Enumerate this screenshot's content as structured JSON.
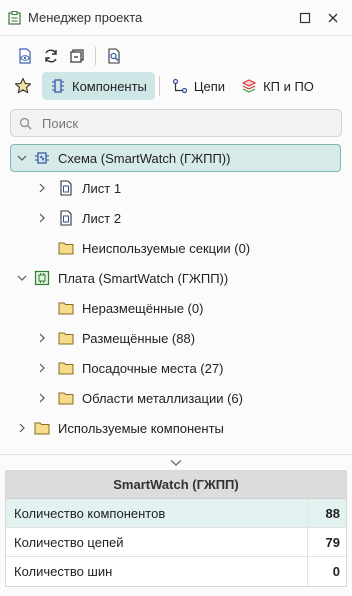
{
  "window": {
    "title": "Менеджер проекта",
    "app_icon": "project-manager-icon",
    "maximize_icon": "maximize-icon",
    "close_icon": "close-icon"
  },
  "toolbar": {
    "buttons": [
      {
        "name": "visibility-icon"
      },
      {
        "name": "refresh-icon"
      },
      {
        "name": "collapse-icon"
      },
      {
        "name": "filter-search-icon"
      }
    ]
  },
  "tabs": [
    {
      "label": "Компоненты",
      "icon": "components-icon",
      "active": true
    },
    {
      "label": "Цепи",
      "icon": "nets-icon",
      "active": false
    },
    {
      "label": "КП и ПО",
      "icon": "layers-icon",
      "active": false
    }
  ],
  "search": {
    "placeholder": "Поиск"
  },
  "tree": [
    {
      "label": "Схема (SmartWatch (ГЖПП))",
      "level": 0,
      "expanded": true,
      "icon": "schematic-icon",
      "selected": true
    },
    {
      "label": "Лист 1",
      "level": 1,
      "expanded": false,
      "icon": "sheet-icon"
    },
    {
      "label": "Лист 2",
      "level": 1,
      "expanded": false,
      "icon": "sheet-icon"
    },
    {
      "label": "Неиспользуемые секции (0)",
      "level": 1,
      "expanded": null,
      "icon": "folder-icon"
    },
    {
      "label": "Плата (SmartWatch (ГЖПП))",
      "level": 0,
      "expanded": true,
      "icon": "board-icon"
    },
    {
      "label": "Неразмещённые (0)",
      "level": 1,
      "expanded": null,
      "icon": "folder-icon"
    },
    {
      "label": "Размещённые (88)",
      "level": 1,
      "expanded": false,
      "icon": "folder-icon"
    },
    {
      "label": "Посадочные места (27)",
      "level": 1,
      "expanded": false,
      "icon": "folder-icon"
    },
    {
      "label": "Области металлизации (6)",
      "level": 1,
      "expanded": false,
      "icon": "folder-icon"
    },
    {
      "label": "Используемые компоненты",
      "level": 0,
      "expanded": false,
      "icon": "folder-icon"
    }
  ],
  "properties": {
    "title": "SmartWatch (ГЖПП)",
    "rows": [
      {
        "key": "Количество компонентов",
        "value": "88",
        "highlight": true
      },
      {
        "key": "Количество цепей",
        "value": "79",
        "highlight": false
      },
      {
        "key": "Количество шин",
        "value": "0",
        "highlight": false
      }
    ]
  },
  "colors": {
    "accent": "#cfe6e6",
    "selection_border": "#7fb8b3",
    "folder": "#e8c86a"
  }
}
